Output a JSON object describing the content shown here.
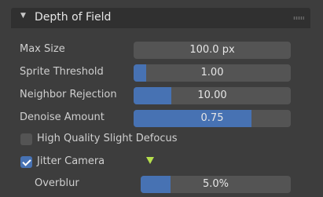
{
  "panel": {
    "title": "Depth of Field",
    "collapse_icon": "disclosure-triangle-down-icon",
    "grip_icon": "drag-grip-icon"
  },
  "fields": [
    {
      "label": "Max Size",
      "value": "100.0 px",
      "fill_fraction": 0
    },
    {
      "label": "Sprite Threshold",
      "value": "1.00",
      "fill_fraction": 0.08
    },
    {
      "label": "Neighbor Rejection",
      "value": "10.00",
      "fill_fraction": 0.24
    },
    {
      "label": "Denoise Amount",
      "value": "0.75",
      "fill_fraction": 0.75
    }
  ],
  "checkboxes": [
    {
      "label": "High Quality Slight Defocus",
      "checked": false
    },
    {
      "label": "Jitter Camera",
      "checked": true
    }
  ],
  "animate_icon": "keyframe-triangle-icon",
  "overblur": {
    "label": "Overblur",
    "value": "5.0%",
    "fill_fraction": 0.2
  },
  "colors": {
    "accent": "#4772b3",
    "field_bg": "#545454",
    "panel_bg": "#3d3d3d",
    "keyframe": "#b6e04c"
  }
}
